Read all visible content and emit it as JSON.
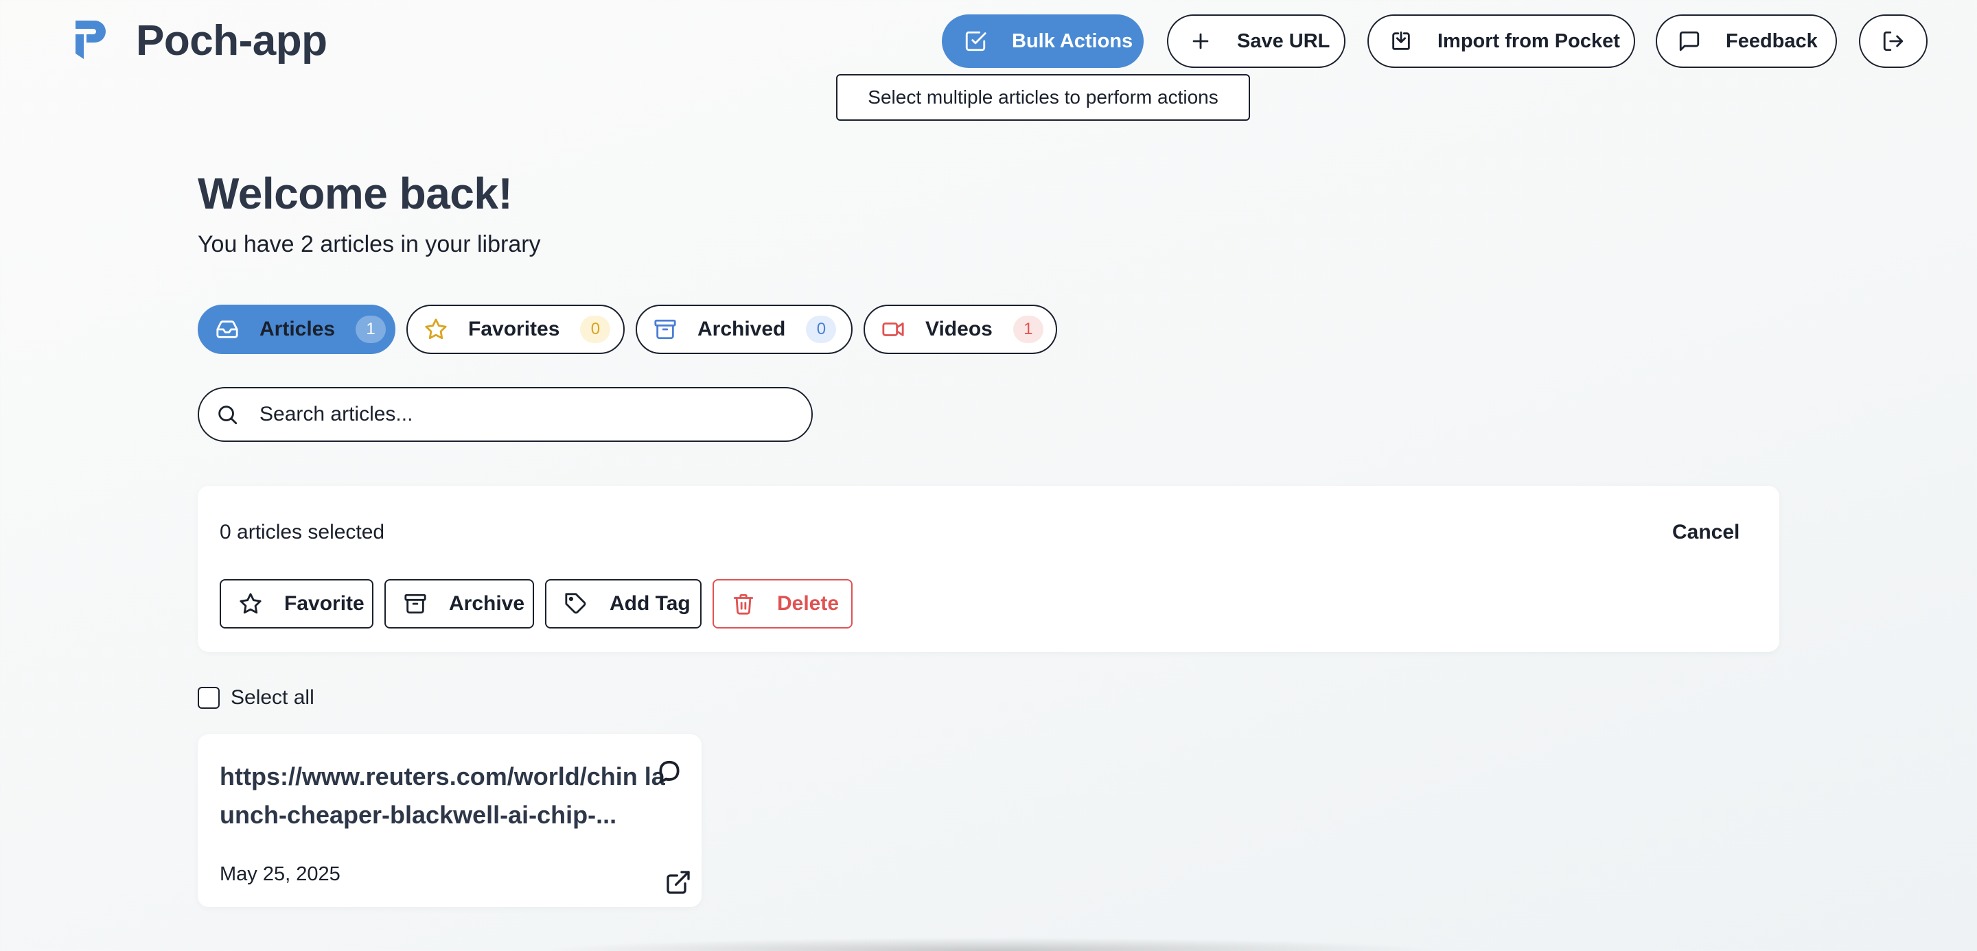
{
  "header": {
    "app_title": "Poch-app",
    "buttons": {
      "bulk_actions": "Bulk Actions",
      "save_url": "Save URL",
      "import_pocket": "Import from Pocket",
      "feedback": "Feedback"
    },
    "tooltip": "Select multiple articles to perform actions"
  },
  "welcome": {
    "title": "Welcome back!",
    "subtitle": "You have 2 articles in your library"
  },
  "tabs": [
    {
      "label": "Articles",
      "count": "1",
      "icon": "inbox-icon",
      "active": true
    },
    {
      "label": "Favorites",
      "count": "0",
      "icon": "star-icon"
    },
    {
      "label": "Archived",
      "count": "0",
      "icon": "archive-icon"
    },
    {
      "label": "Videos",
      "count": "1",
      "icon": "video-icon"
    }
  ],
  "search": {
    "placeholder": "Search articles..."
  },
  "bulk_panel": {
    "selected_text": "0 articles selected",
    "cancel_label": "Cancel",
    "actions": {
      "favorite": "Favorite",
      "archive": "Archive",
      "add_tag": "Add Tag",
      "delete": "Delete"
    }
  },
  "select_all_label": "Select all",
  "articles": [
    {
      "title": "https://www.reuters.com/world/chin launch-cheaper-blackwell-ai-chip-...",
      "date": "May 25, 2025"
    }
  ],
  "colors": {
    "primary": "#4a8ad4",
    "text": "#2d3748",
    "danger": "#e05252",
    "favorites_accent": "#d9a521",
    "archived_accent": "#4a7fd4",
    "videos_accent": "#e05252"
  }
}
